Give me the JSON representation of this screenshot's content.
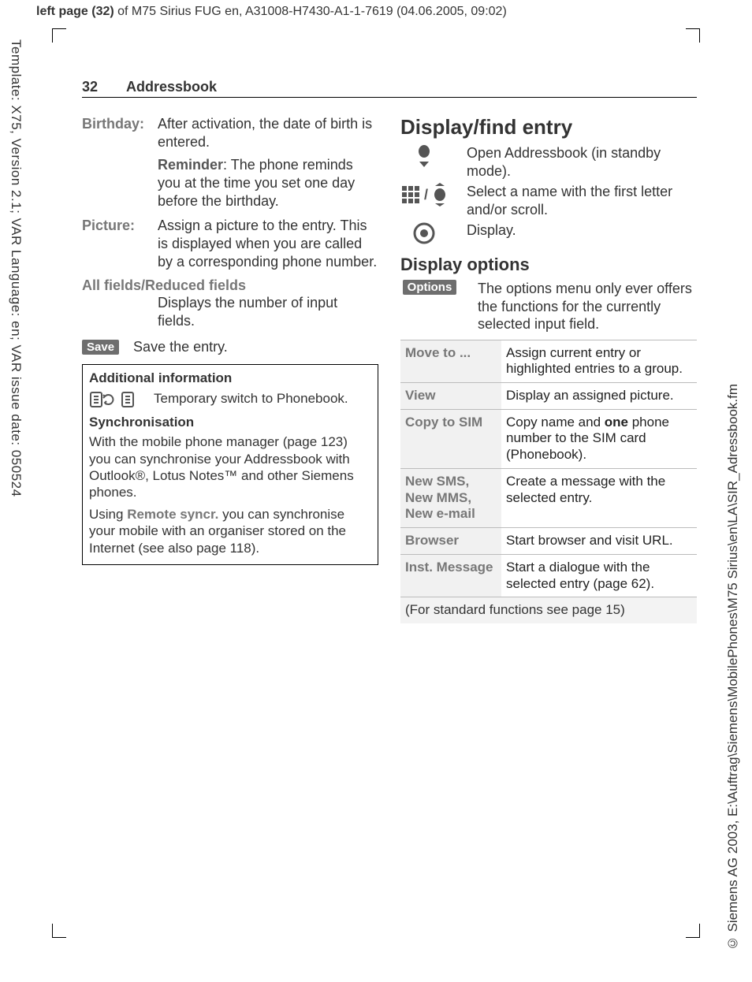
{
  "meta": {
    "top_bold": "left page (32)",
    "top_rest": " of M75 Sirius FUG en, A31008-H7430-A1-1-7619 (04.06.2005, 09:02)",
    "left": "Template: X75, Version 2.1; VAR Language: en; VAR issue date: 050524",
    "right": "© Siemens AG 2003, E:\\Auftrag\\Siemens\\MobilePhones\\M75 Sirius\\en\\LA\\SIR_Adressbook.fm"
  },
  "header": {
    "page_no": "32",
    "section": "Addressbook"
  },
  "left": {
    "birthday": {
      "label": "Birthday:",
      "p1": "After activation, the date of birth is entered.",
      "rem_b": "Reminder",
      "rem_rest": ": The phone reminds you at the time you set one day before the birthday."
    },
    "picture": {
      "label": "Picture:",
      "text": "Assign a picture to the entry. This is displayed when you are called by a corresponding phone number."
    },
    "fields": {
      "title": "All fields/Reduced fields",
      "text": "Displays the number of input fields."
    },
    "save": {
      "pill": "Save",
      "text": "Save the entry."
    },
    "box": {
      "title": "Additional information",
      "switch": "Temporary switch to Phonebook.",
      "sync_h": "Synchronisation",
      "sync_p1": "With the mobile phone manager (page 123) you can synchronise your Addressbook with Outlook®, Lotus Notes™ and other Siemens phones.",
      "sync_p2a": "Using ",
      "sync_p2b": "Remote syncr.",
      "sync_p2c": " you can synchronise your mobile with an organiser stored on the Internet (see also page 118)."
    }
  },
  "right": {
    "h2": "Display/find entry",
    "open": "Open Addressbook (in standby mode).",
    "select": "Select a name with the first letter and/or scroll.",
    "display": "Display.",
    "h3": "Display options",
    "opt_pill": "Options",
    "opt_text": "The options menu only ever offers the functions for the currently selected input field.",
    "table": [
      {
        "k": "Move to ...",
        "v": "Assign current entry or highlighted entries to a group."
      },
      {
        "k": "View",
        "v": "Display an assigned picture."
      },
      {
        "k": "Copy to SIM",
        "v_pre": "Copy name and ",
        "v_b": "one",
        "v_post": " phone number to the SIM card (Phonebook)."
      },
      {
        "k": "New SMS, New MMS, New e-mail",
        "v": "Create a message with the selected entry."
      },
      {
        "k": "Browser",
        "v": "Start browser and visit URL."
      },
      {
        "k": "Inst. Message",
        "v": "Start a dialogue with the selected entry (page 62)."
      }
    ],
    "footer": "(For standard functions see page 15)"
  }
}
